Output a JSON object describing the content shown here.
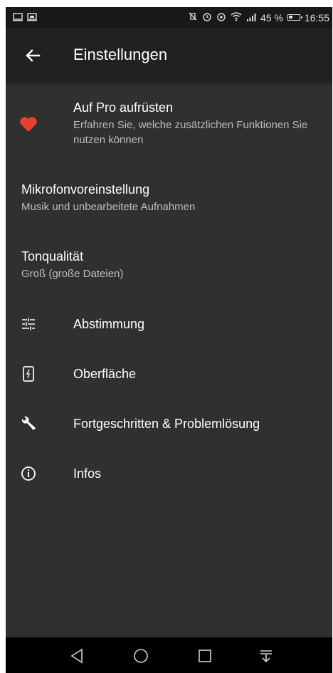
{
  "status_bar": {
    "battery_percent": "45 %",
    "battery_level": 0.45,
    "time": "16:55",
    "left_icons": [
      "notification-icon",
      "screen-cast-icon"
    ],
    "right_icons": [
      "vibrate-off-icon",
      "alarm-icon",
      "eye-comfort-icon",
      "wifi-icon",
      "signal-icon",
      "battery-icon"
    ]
  },
  "appbar": {
    "back_icon": "arrow-back-icon",
    "title": "Einstellungen"
  },
  "settings": {
    "pro": {
      "icon": "heart-icon",
      "icon_color": "#e8402c",
      "title": "Auf Pro aufrüsten",
      "subtitle": "Erfahren Sie, welche zusätzlichen Funktionen Sie nutzen können"
    },
    "mic_preset": {
      "title": "Mikrofonvoreinstellung",
      "subtitle": "Musik und unbearbeitete Aufnahmen"
    },
    "quality": {
      "title": "Tonqualität",
      "subtitle": "Groß (große Dateien)"
    },
    "tuning": {
      "icon": "sliders-icon",
      "title": "Abstimmung"
    },
    "interface": {
      "icon": "phone-screen-icon",
      "title": "Oberfläche"
    },
    "advanced": {
      "icon": "wrench-icon",
      "title": "Fortgeschritten & Problemlösung"
    },
    "info": {
      "icon": "info-icon",
      "title": "Infos"
    }
  },
  "nav_bar": {
    "buttons": [
      "back-icon",
      "home-icon",
      "recents-icon",
      "notification-shade-icon"
    ]
  },
  "colors": {
    "background": "#303030",
    "appbar": "#212121",
    "status_bar": "#181818",
    "accent_heart": "#e8402c"
  }
}
